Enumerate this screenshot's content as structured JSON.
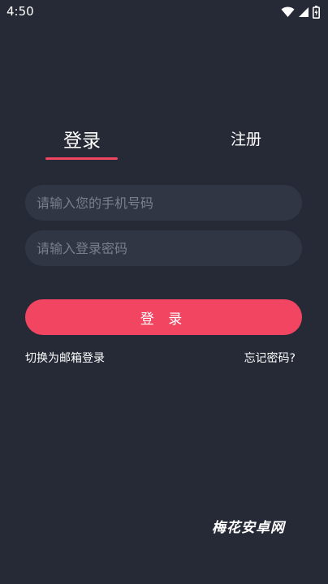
{
  "status_bar": {
    "time": "4:50",
    "icons": [
      "wifi-icon",
      "signal-icon",
      "battery-icon"
    ]
  },
  "tabs": {
    "login_label": "登录",
    "register_label": "注册",
    "active": "login"
  },
  "form": {
    "phone_placeholder": "请输入您的手机号码",
    "password_placeholder": "请输入登录密码",
    "phone_value": "",
    "password_value": "",
    "submit_label": "登 录"
  },
  "links": {
    "switch_email": "切换为邮箱登录",
    "forgot_password": "忘记密码?"
  },
  "watermark": "梅花安卓网",
  "colors": {
    "background": "#252a36",
    "input_background": "#313644",
    "accent": "#f24561",
    "placeholder": "#7a7f8c",
    "text": "#ffffff"
  }
}
